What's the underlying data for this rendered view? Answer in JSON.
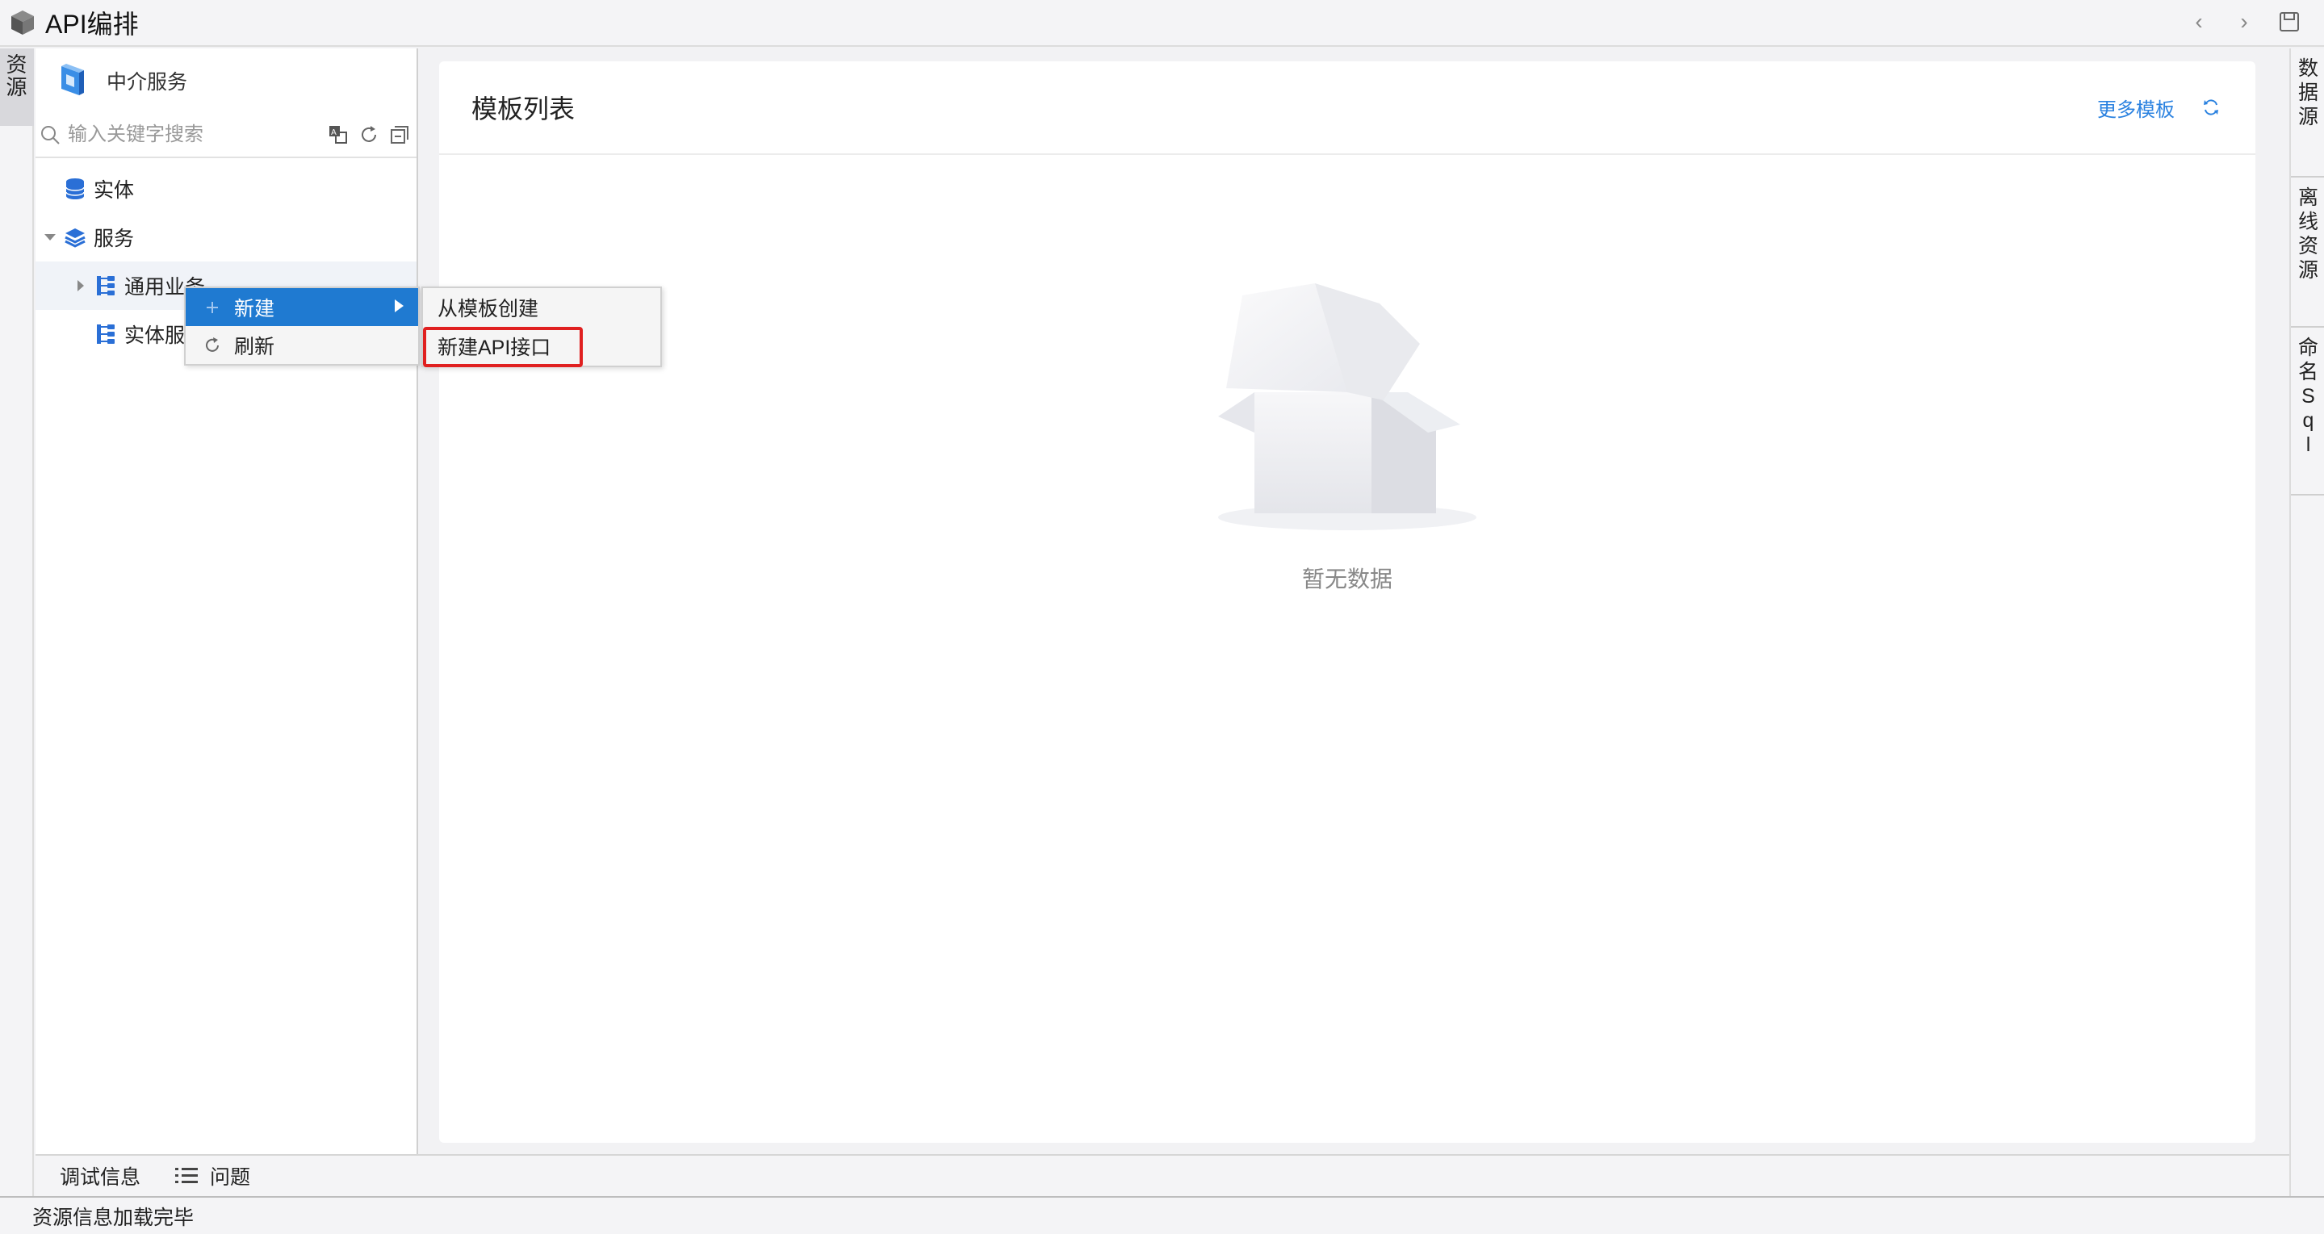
{
  "window": {
    "title": "API编排",
    "nav_back": "‹",
    "nav_forward": "›"
  },
  "left_strip": {
    "tab_label": "资源"
  },
  "sidebar": {
    "header_name": "中介服务",
    "search_placeholder": "输入关键字搜索",
    "tree": [
      {
        "label": "实体",
        "icon": "database-icon"
      },
      {
        "label": "服务",
        "icon": "layers-icon",
        "expanded": true
      },
      {
        "label": "通用业务",
        "icon": "flow-icon"
      },
      {
        "label": "实体服",
        "icon": "flow-icon"
      }
    ]
  },
  "context_menu": {
    "items": [
      {
        "label": "新建",
        "icon": "plus-icon",
        "has_submenu": true
      },
      {
        "label": "刷新",
        "icon": "refresh-icon"
      }
    ],
    "submenu": [
      {
        "label": "从模板创建"
      },
      {
        "label": "新建API接口"
      }
    ]
  },
  "main": {
    "card_title": "模板列表",
    "more_templates": "更多模板",
    "empty_text": "暂无数据"
  },
  "right_strip": {
    "tabs": [
      {
        "label": [
          "数",
          "据",
          "源"
        ]
      },
      {
        "label": [
          "离",
          "线",
          "资",
          "源"
        ]
      },
      {
        "label": [
          "命",
          "名",
          "S",
          "q",
          "l"
        ]
      }
    ]
  },
  "bottom_bar": {
    "debug_info": "调试信息",
    "problems": "问题"
  },
  "status": {
    "text": "资源信息加载完毕"
  },
  "colors": {
    "accent": "#1f7ad1",
    "link": "#2b82e0",
    "highlight": "#e02020",
    "tree_icon": "#2a6fd6"
  }
}
